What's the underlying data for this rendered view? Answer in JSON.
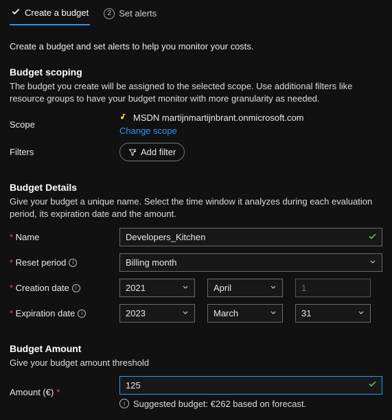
{
  "tabs": {
    "step1": {
      "label": "Create a budget"
    },
    "step2": {
      "number": "2",
      "label": "Set alerts"
    }
  },
  "intro": "Create a budget and set alerts to help you monitor your costs.",
  "scoping": {
    "heading": "Budget scoping",
    "desc": "The budget you create will be assigned to the selected scope. Use additional filters like resource groups to have your budget monitor with more granularity as needed.",
    "scope_label": "Scope",
    "scope_value": "MSDN martijnmartijnbrant.onmicrosoft.com",
    "change_scope": "Change scope",
    "filters_label": "Filters",
    "add_filter": "Add filter"
  },
  "details": {
    "heading": "Budget Details",
    "desc": "Give your budget a unique name. Select the time window it analyzes during each evaluation period, its expiration date and the amount.",
    "name_label": "Name",
    "name_value": "Developers_Kitchen",
    "reset_label": "Reset period",
    "reset_value": "Billing month",
    "creation_label": "Creation date",
    "creation_year": "2021",
    "creation_month": "April",
    "creation_day": "1",
    "expiration_label": "Expiration date",
    "expiration_year": "2023",
    "expiration_month": "March",
    "expiration_day": "31"
  },
  "amount": {
    "heading": "Budget Amount",
    "desc": "Give your budget amount threshold",
    "label": "Amount (€)",
    "value": "125",
    "suggested": "Suggested budget: €262 based on forecast."
  }
}
